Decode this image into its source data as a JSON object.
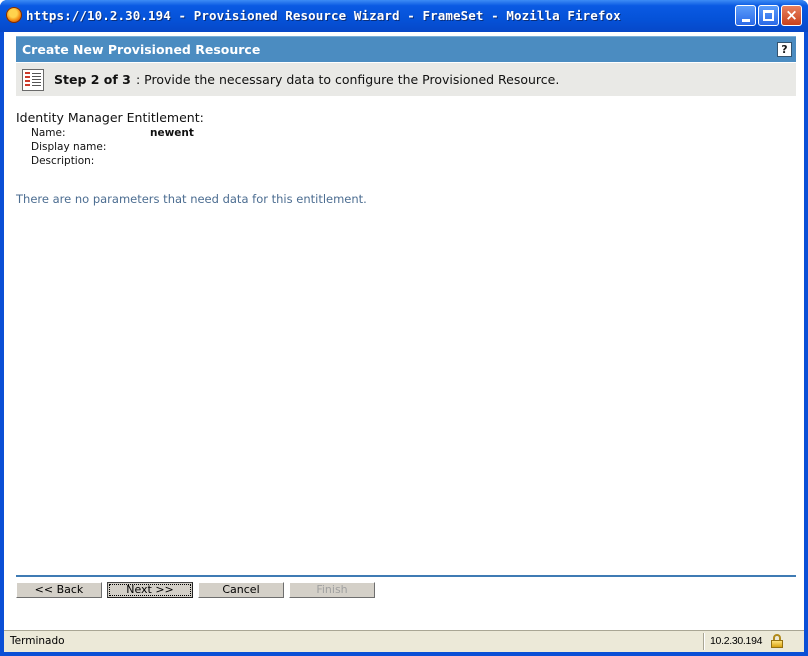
{
  "window": {
    "title": "https://10.2.30.194 - Provisioned Resource Wizard - FrameSet - Mozilla Firefox",
    "icon": "firefox-icon",
    "controls": {
      "minimize": "_",
      "maximize": "□",
      "close": "×"
    }
  },
  "header": {
    "title": "Create New Provisioned Resource",
    "help_label": "?"
  },
  "step": {
    "label": "Step 2 of 3",
    "text": ":  Provide the necessary data to configure the Provisioned Resource."
  },
  "entitlement": {
    "section_title": "Identity Manager Entitlement:",
    "fields": [
      {
        "label": "Name:",
        "value": "newent"
      },
      {
        "label": "Display name:",
        "value": ""
      },
      {
        "label": "Description:",
        "value": ""
      }
    ]
  },
  "message": "There are no parameters that need data for this entitlement.",
  "buttons": {
    "back": "<< Back",
    "next": "Next >>",
    "cancel": "Cancel",
    "finish": "Finish"
  },
  "statusbar": {
    "status": "Terminado",
    "host": "10.2.30.194",
    "icon": "lock-icon"
  },
  "colors": {
    "header_bg": "#4b8cc1",
    "step_bg": "#e9e9e6",
    "message_text": "#4c6d91",
    "divider": "#3f7bb4"
  }
}
